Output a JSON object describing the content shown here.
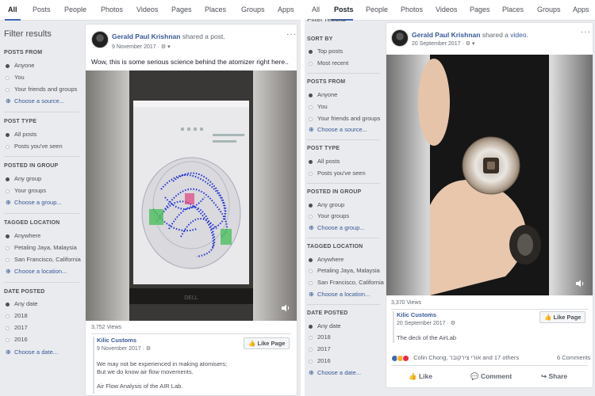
{
  "left": {
    "tabs": [
      "All",
      "Posts",
      "People",
      "Photos",
      "Videos",
      "Pages",
      "Places",
      "Groups",
      "Apps"
    ],
    "active_tab": "All",
    "filter_title": "Filter results",
    "filters": {
      "posts_from": {
        "heading": "POSTS FROM",
        "options": [
          "Anyone",
          "You",
          "Your friends and groups"
        ],
        "more": "Choose a source..."
      },
      "post_type": {
        "heading": "POST TYPE",
        "options": [
          "All posts",
          "Posts you've seen"
        ]
      },
      "posted_in_group": {
        "heading": "POSTED IN GROUP",
        "options": [
          "Any group",
          "Your groups"
        ],
        "more": "Choose a group..."
      },
      "tagged_location": {
        "heading": "TAGGED LOCATION",
        "options": [
          "Anywhere",
          "Petaling Jaya, Malaysia",
          "San Francisco, California"
        ],
        "more": "Choose a location..."
      },
      "date_posted": {
        "heading": "DATE POSTED",
        "options": [
          "Any date",
          "2018",
          "2017",
          "2016"
        ],
        "more": "Choose a date..."
      }
    },
    "post": {
      "author": "Gerald Paul Krishnan",
      "action": "shared a post.",
      "date": "9 November 2017",
      "privacy": "·",
      "more": "···",
      "text": "Wow, this is some serious science behind the atomizer right here..",
      "views": "3,752 Views",
      "source_name": "Kilic Customs",
      "source_date": "9 November 2017",
      "like_page": "Like Page",
      "source_text": [
        "We may not be experienced in making atomisers;",
        "But we do know air flow movements.",
        "",
        "Air Flow Analysis of the AIR Lab."
      ],
      "monitor_brand": "DELL"
    }
  },
  "right": {
    "tabs": [
      "All",
      "Posts",
      "People",
      "Photos",
      "Videos",
      "Pages",
      "Places",
      "Groups",
      "Apps"
    ],
    "active_tab": "Posts",
    "filter_title": "Filter results",
    "filters": {
      "sort_by": {
        "heading": "SORT BY",
        "options": [
          "Top posts",
          "Most recent"
        ]
      },
      "posts_from": {
        "heading": "POSTS FROM",
        "options": [
          "Anyone",
          "You",
          "Your friends and groups"
        ],
        "more": "Choose a source..."
      },
      "post_type": {
        "heading": "POST TYPE",
        "options": [
          "All posts",
          "Posts you've seen"
        ]
      },
      "posted_in_group": {
        "heading": "POSTED IN GROUP",
        "options": [
          "Any group",
          "Your groups"
        ],
        "more": "Choose a group..."
      },
      "tagged_location": {
        "heading": "TAGGED LOCATION",
        "options": [
          "Anywhere",
          "Petaling Jaya, Malaysia",
          "San Francisco, California"
        ],
        "more": "Choose a location..."
      },
      "date_posted": {
        "heading": "DATE POSTED",
        "options": [
          "Any date",
          "2018",
          "2017",
          "2016"
        ],
        "more": "Choose a date..."
      }
    },
    "post": {
      "author": "Gerald Paul Krishnan",
      "action": "shared a",
      "action_link": "video.",
      "date": "20 September 2017",
      "more": "···",
      "views": "3,370 Views",
      "source_name": "Kilic Customs",
      "source_date": "20 September 2017",
      "like_page": "Like Page",
      "source_text": "The deck of the AirLab",
      "reactions_text": "Colin Chong, אורי צירקובר and 17 others",
      "comments": "6 Comments",
      "actions": [
        "Like",
        "Comment",
        "Share"
      ]
    }
  },
  "colors": {
    "accent": "#4267b2",
    "link": "#385898",
    "bg": "#e9ebee"
  }
}
